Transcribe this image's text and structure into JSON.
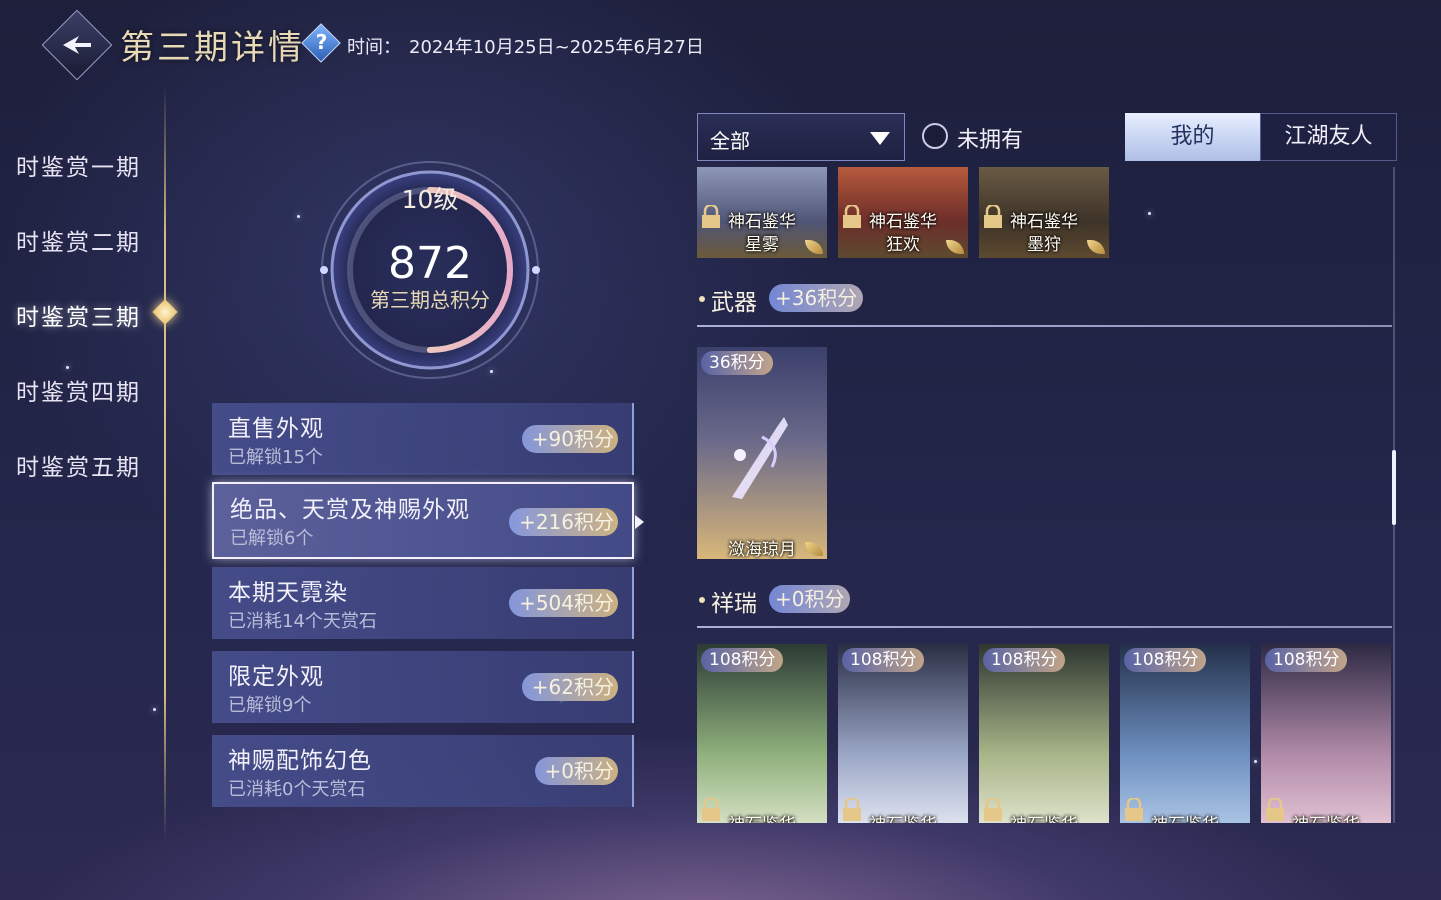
{
  "header": {
    "title": "第三期详情",
    "time_label": "时间：",
    "time_value": "2024年10月25日~2025年6月27日"
  },
  "nav": {
    "items": [
      {
        "label": "时鉴赏一期"
      },
      {
        "label": "时鉴赏二期"
      },
      {
        "label": "时鉴赏三期"
      },
      {
        "label": "时鉴赏四期"
      },
      {
        "label": "时鉴赏五期"
      }
    ],
    "active_index": 2
  },
  "summary": {
    "level": "10级",
    "score": "872",
    "caption": "第三期总积分",
    "level_progress": 0.5
  },
  "categories": [
    {
      "title": "直售外观",
      "sub": "已解锁15个",
      "points": "+90积分"
    },
    {
      "title": "绝品、天赏及神赐外观",
      "sub": "已解锁6个",
      "points": "+216积分"
    },
    {
      "title": "本期天霓染",
      "sub": "已消耗14个天赏石",
      "points": "+504积分"
    },
    {
      "title": "限定外观",
      "sub": "已解锁9个",
      "points": "+62积分"
    },
    {
      "title": "神赐配饰幻色",
      "sub": "已消耗0个天赏石",
      "points": "+0积分"
    }
  ],
  "filter": {
    "selected": "全部",
    "owned_label": "未拥有"
  },
  "tabs": {
    "mine": "我的",
    "friends": "江湖友人"
  },
  "top_row": [
    {
      "name": "神石鉴华\n星雾"
    },
    {
      "name": "神石鉴华\n狂欢"
    },
    {
      "name": "神石鉴华\n墨狩"
    }
  ],
  "sections": {
    "weapon": {
      "title": "武器",
      "points": "+36积分",
      "items": [
        {
          "tag": "36积分",
          "name": "潋海琼月"
        }
      ]
    },
    "auspicious": {
      "title": "祥瑞",
      "points": "+0积分",
      "items": [
        {
          "tag": "108积分",
          "name": "神石鉴华"
        },
        {
          "tag": "108积分",
          "name": "神石鉴华"
        },
        {
          "tag": "108积分",
          "name": "神石鉴华"
        },
        {
          "tag": "108积分",
          "name": "神石鉴华"
        },
        {
          "tag": "108积分",
          "name": "神石鉴华"
        }
      ]
    }
  },
  "colors": {
    "background": "#1f2140",
    "gold": "#e7d9b4",
    "card_blue": "#464e8c",
    "tab_active": "#dfe8ff"
  }
}
